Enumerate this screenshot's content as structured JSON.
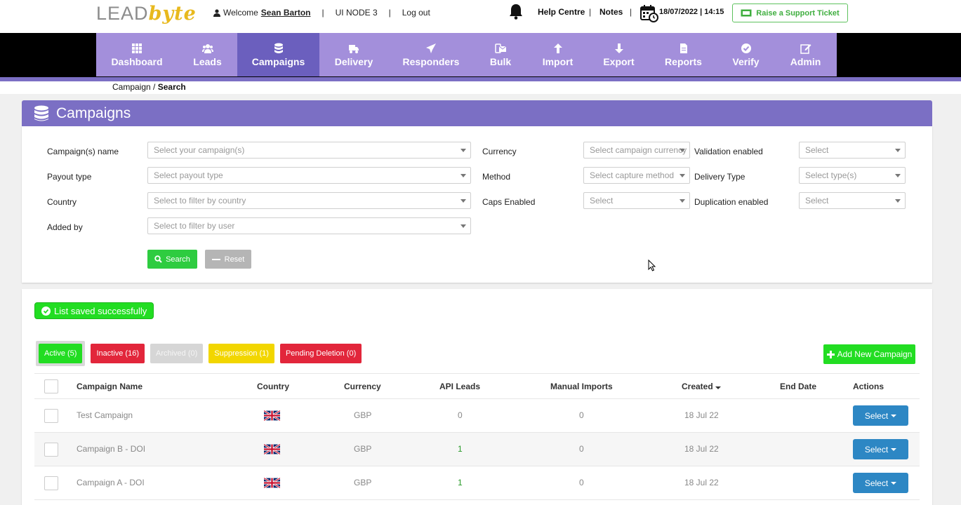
{
  "header": {
    "logo_lead": "LEAD",
    "logo_byte": "byte",
    "welcome_prefix": "Welcome",
    "user_name": "Sean Barton",
    "node": "UI NODE 3",
    "logout": "Log out",
    "help": "Help Centre",
    "notes": "Notes",
    "datetime": "18/07/2022 | 14:15",
    "ticket": "Raise a Support Ticket",
    "sep": "|"
  },
  "nav": [
    {
      "label": "Dashboard",
      "icon": "grid-icon",
      "width": 116
    },
    {
      "label": "Leads",
      "icon": "users-icon",
      "width": 85
    },
    {
      "label": "Campaigns",
      "icon": "database-icon",
      "width": 117,
      "active": true
    },
    {
      "label": "Delivery",
      "icon": "truck-icon",
      "width": 98
    },
    {
      "label": "Responders",
      "icon": "paper-plane-icon",
      "width": 122
    },
    {
      "label": "Bulk",
      "icon": "envelopes-icon",
      "width": 76
    },
    {
      "label": "Import",
      "icon": "arrow-up-icon",
      "width": 87
    },
    {
      "label": "Export",
      "icon": "arrow-down-icon",
      "width": 87
    },
    {
      "label": "Reports",
      "icon": "file-icon",
      "width": 97
    },
    {
      "label": "Verify",
      "icon": "check-circle-icon",
      "width": 81
    },
    {
      "label": "Admin",
      "icon": "edit-icon",
      "width": 89
    }
  ],
  "breadcrumb": {
    "parent": "Campaign",
    "sep": " / ",
    "current": "Search"
  },
  "panel_title": "Campaigns",
  "filters": {
    "campaign_name": {
      "label": "Campaign(s) name",
      "placeholder": "Select your campaign(s)"
    },
    "payout_type": {
      "label": "Payout type",
      "placeholder": "Select payout type"
    },
    "country": {
      "label": "Country",
      "placeholder": "Select to filter by country"
    },
    "added_by": {
      "label": "Added by",
      "placeholder": "Select to filter by user"
    },
    "currency": {
      "label": "Currency",
      "placeholder": "Select campaign currency"
    },
    "method": {
      "label": "Method",
      "placeholder": "Select capture method"
    },
    "caps": {
      "label": "Caps Enabled",
      "placeholder": "Select"
    },
    "validation": {
      "label": "Validation enabled",
      "placeholder": "Select"
    },
    "delivery_type": {
      "label": "Delivery Type",
      "placeholder": "Select type(s)"
    },
    "duplication": {
      "label": "Duplication enabled",
      "placeholder": "Select"
    },
    "search_label": "Search",
    "reset_label": "Reset"
  },
  "toast": "List saved successfully",
  "tabs": {
    "active": "Active (5)",
    "inactive": "Inactive (16)",
    "archived": "Archived (0)",
    "suppression": "Suppression (1)",
    "pending": "Pending Deletion (0)"
  },
  "add_campaign": "Add New Campaign",
  "table": {
    "headers": {
      "name": "Campaign Name",
      "country": "Country",
      "currency": "Currency",
      "api": "API Leads",
      "manual": "Manual Imports",
      "created": "Created",
      "end": "End Date",
      "actions": "Actions"
    },
    "rows": [
      {
        "name": "Test Campaign",
        "country": "uk-flag-icon",
        "currency": "GBP",
        "api": "0",
        "manual": "0",
        "created": "18 Jul 22",
        "end": "",
        "action": "Select"
      },
      {
        "name": "Campaign B - DOI",
        "country": "uk-flag-icon",
        "currency": "GBP",
        "api": "1",
        "manual": "0",
        "created": "18 Jul 22",
        "end": "",
        "action": "Select"
      },
      {
        "name": "Campaign A - DOI",
        "country": "uk-flag-icon",
        "currency": "GBP",
        "api": "1",
        "manual": "0",
        "created": "18 Jul 22",
        "end": "",
        "action": "Select"
      }
    ]
  },
  "colors": {
    "brand_purple": "#7b6fc4",
    "nav_purple": "#a38fdb",
    "active_nav": "#6b5fbe",
    "green": "#22dd22",
    "red": "#e2263b",
    "blue": "#2d87c4"
  }
}
